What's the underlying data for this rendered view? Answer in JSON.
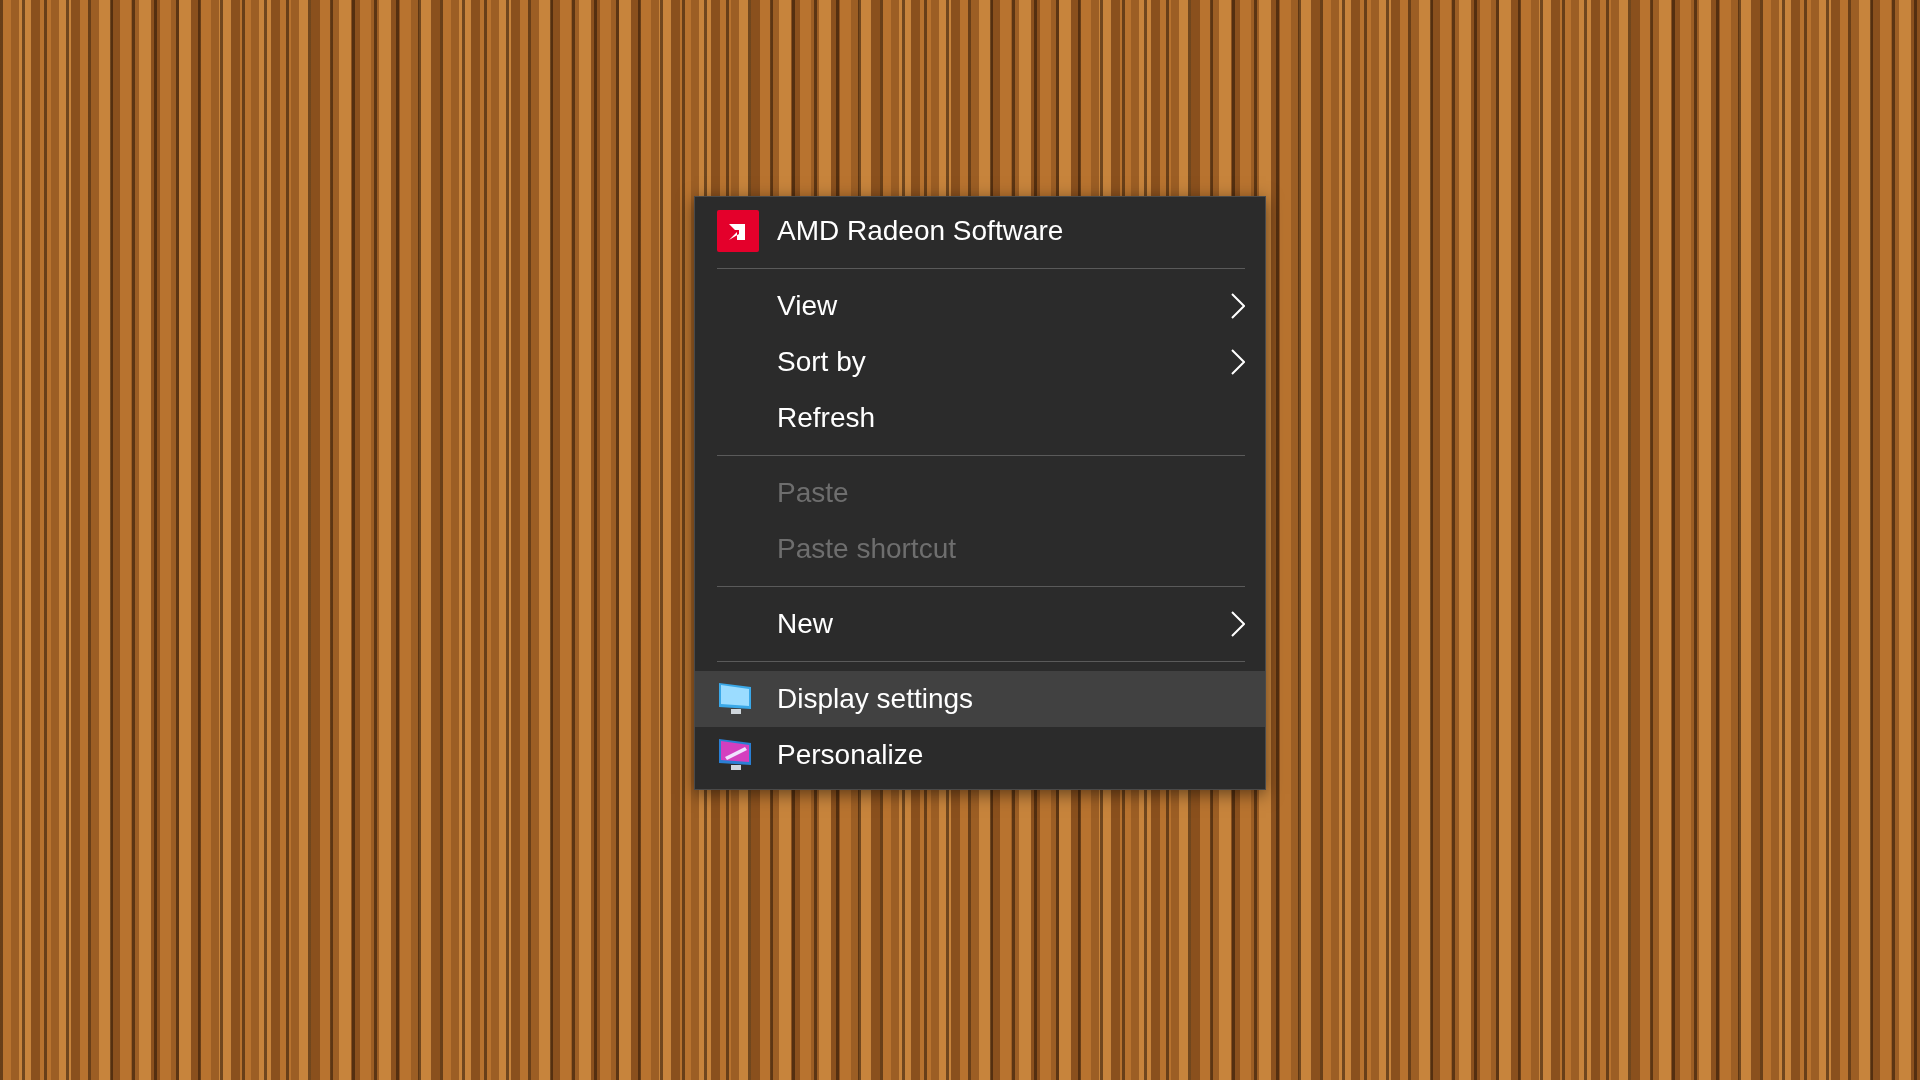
{
  "context_menu": {
    "items": [
      {
        "kind": "radeon",
        "label": "AMD Radeon Software",
        "selected": false,
        "disabled": false,
        "submenu": false
      },
      {
        "kind": "separator"
      },
      {
        "kind": "item",
        "label": "View",
        "selected": false,
        "disabled": false,
        "submenu": true
      },
      {
        "kind": "item",
        "label": "Sort by",
        "selected": false,
        "disabled": false,
        "submenu": true
      },
      {
        "kind": "item",
        "label": "Refresh",
        "selected": false,
        "disabled": false,
        "submenu": false
      },
      {
        "kind": "separator"
      },
      {
        "kind": "item",
        "label": "Paste",
        "selected": false,
        "disabled": true,
        "submenu": false
      },
      {
        "kind": "item",
        "label": "Paste shortcut",
        "selected": false,
        "disabled": true,
        "submenu": false
      },
      {
        "kind": "separator"
      },
      {
        "kind": "item",
        "label": "New",
        "selected": false,
        "disabled": false,
        "submenu": true
      },
      {
        "kind": "separator"
      },
      {
        "kind": "display",
        "label": "Display settings",
        "selected": true,
        "disabled": false,
        "submenu": false
      },
      {
        "kind": "personalize",
        "label": "Personalize",
        "selected": false,
        "disabled": false,
        "submenu": false
      }
    ]
  }
}
